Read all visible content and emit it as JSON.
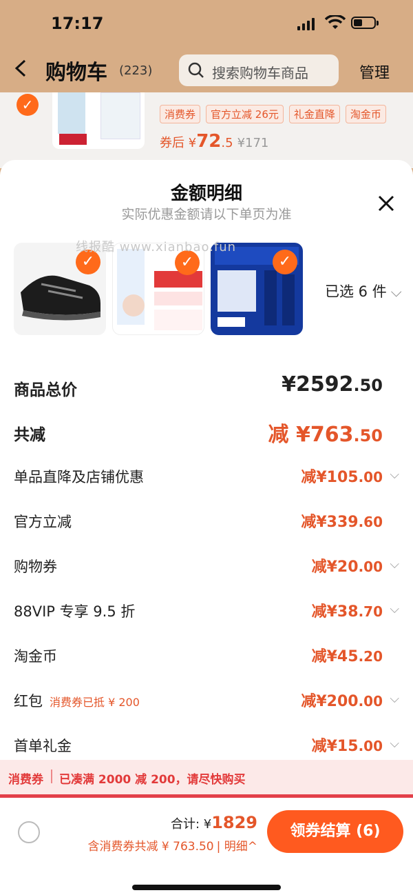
{
  "status": {
    "time": "17:17"
  },
  "header": {
    "back_icon": "chevron-left-icon",
    "title": "购物车",
    "count": "(223)",
    "search_placeholder": "搜索购物车商品",
    "manage": "管理"
  },
  "background_item": {
    "tags": [
      "消费券",
      "官方立减 26元",
      "礼金直降",
      "淘金币"
    ],
    "price_label": "券后 ¥",
    "price_int": "72",
    "price_dec": ".5",
    "orig_price": "¥171"
  },
  "sheet": {
    "title": "金额明细",
    "subtitle": "实际优惠金额请以下单页为准",
    "watermark": "线报酷 www.xianbao.fun",
    "selected": "已选 6 件",
    "rows": [
      {
        "label": "商品总价",
        "value": "¥2592",
        "dec": ".50"
      },
      {
        "label": "共减",
        "value": "减 ¥763",
        "dec": ".50"
      },
      {
        "label": "单品直降及店铺优惠",
        "value": "减¥105",
        "dec": ".00"
      },
      {
        "label": "官方立减",
        "value": "减¥339",
        "dec": ".60"
      },
      {
        "label": "购物券",
        "value": "减¥20",
        "dec": ".00"
      },
      {
        "label": "88VIP 专享 9.5 折",
        "value": "减¥38",
        "dec": ".70"
      },
      {
        "label": "淘金币",
        "value": "减¥45",
        "dec": ".20"
      },
      {
        "label": "红包",
        "note": "消费券已抵 ¥ 200",
        "value": "减¥200",
        "dec": ".00"
      },
      {
        "label": "首单礼金",
        "value": "减¥15",
        "dec": ".00"
      }
    ]
  },
  "banner": {
    "tag": "消费券",
    "text": "已凑满 2000 减 200，请尽快购买"
  },
  "footer": {
    "total_label": "合计: ¥",
    "total_amount": "1829",
    "subtotal": "含消费券共减 ¥ 763.50",
    "detail": "| 明细^",
    "checkout": "领券结算 (6)"
  },
  "colors": {
    "accent": "#ff5a1f",
    "price": "#e4562a",
    "header_bg": "#d7ad86"
  }
}
